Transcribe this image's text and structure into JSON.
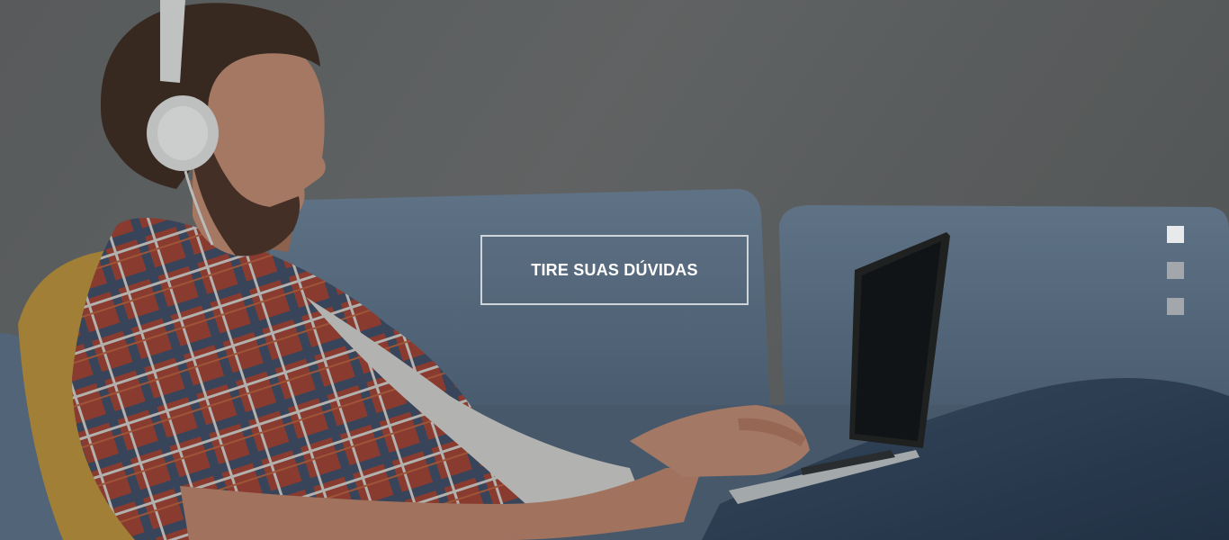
{
  "hero": {
    "cta_label": "TIRE SUAS DÚVIDAS"
  },
  "slider": {
    "dot_count": 3,
    "active_index": 0
  },
  "colors": {
    "dot_active": "#e8e9ea",
    "dot_inactive": "#a3a6ab",
    "cta_border": "#dce0e4",
    "cta_text": "#ffffff",
    "sofa": "#5d7289",
    "wall": "#67696a"
  }
}
